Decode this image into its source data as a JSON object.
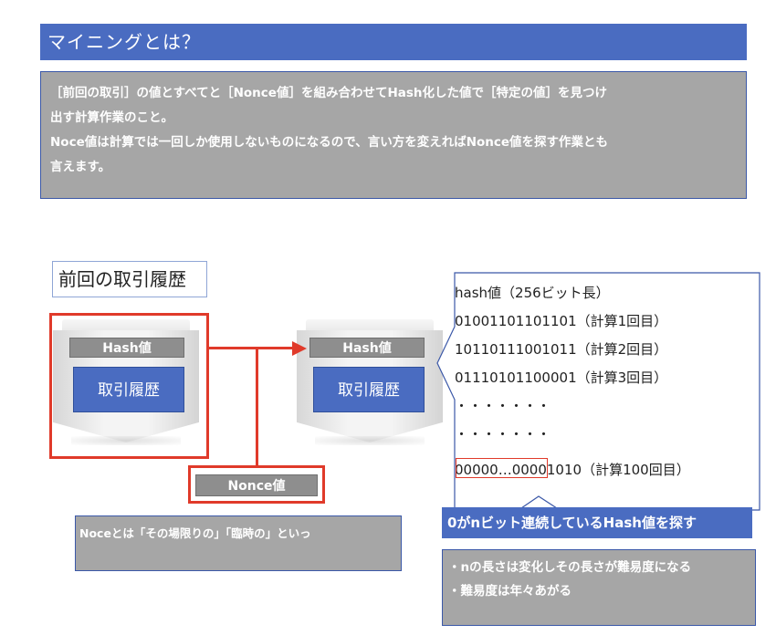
{
  "title": "マイニングとは？",
  "description": {
    "line1": "［前回の取引］の値とすべてと［Nonce値］を組み合わせてHash化した値で［特定の値］を見つけ",
    "line2": "出す計算作業のこと。",
    "line3": "Noce値は計算では一回しか使用しないものになるので、言い方を変えればNonce値を探す作業とも",
    "line4": "言えます。"
  },
  "section_label": "前回の取引履歴",
  "block_left": {
    "hash_label": "Hash値",
    "content_label": "取引履歴"
  },
  "block_right": {
    "hash_label": "Hash値",
    "content_label": "取引履歴"
  },
  "nonce_label": "Nonce値",
  "noce_note": "Noceとは「その場限りの」「臨時の」といっ",
  "hash_list": {
    "header": "hash値（256ビット長）",
    "rows": [
      "01001101101101（計算1回目）",
      "10110111001011（計算2回目）",
      "01110101100001（計算3回目）",
      "・・・・・・・",
      "・・・・・・・",
      "00000…00001010（計算100回目）"
    ]
  },
  "nbit_banner": "0がnビット連続しているHash値を探す",
  "notes": [
    "・nの長さは変化しその長さが難易度になる",
    "・難易度は年々あがる"
  ],
  "colors": {
    "accent_blue": "#4a6cc1",
    "gray_box": "#a6a6a6",
    "label_gray": "#8e8e8e",
    "highlight_red": "#e03a2a"
  }
}
